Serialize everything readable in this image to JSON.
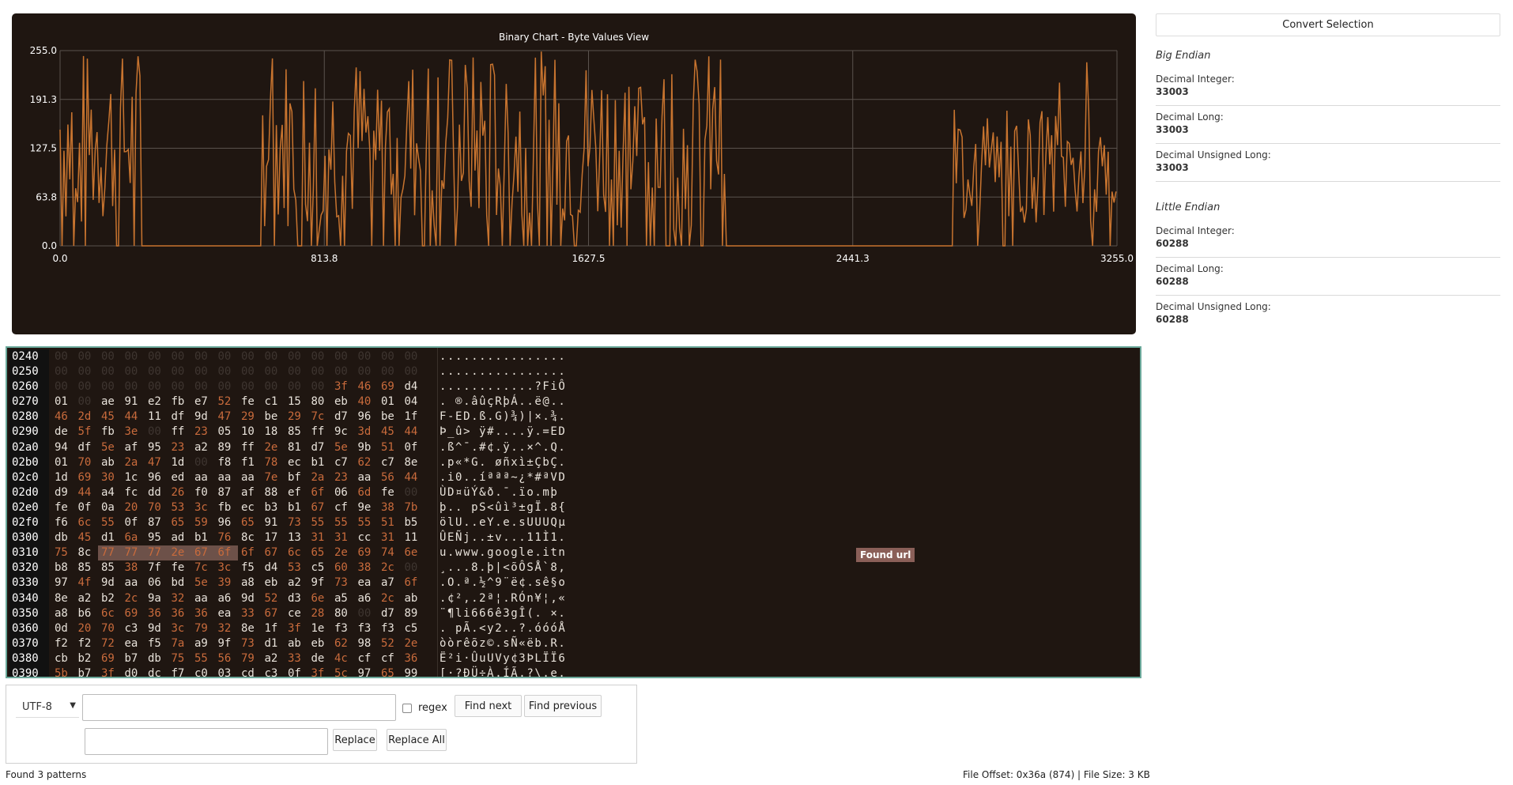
{
  "chart": {
    "title": "Binary Chart - Byte Values View",
    "y_ticks": [
      "255.0",
      "191.3",
      "127.5",
      "63.8",
      "0.0"
    ],
    "x_ticks": [
      "0.0",
      "813.8",
      "1627.5",
      "2441.3",
      "3255.0"
    ],
    "line_color": "#c8742f",
    "background": "#1f1611"
  },
  "chart_data": {
    "type": "line",
    "title": "Binary Chart - Byte Values View",
    "xlim": [
      0,
      3255
    ],
    "ylim": [
      0,
      255
    ],
    "grid": true,
    "series": [
      {
        "values_note_segments": [
          {
            "range": [
              0,
              250
            ],
            "kind": "dense-high"
          },
          {
            "range": [
              250,
              620
            ],
            "kind": "zero"
          },
          {
            "range": [
              620,
              2050
            ],
            "kind": "dense-high"
          },
          {
            "range": [
              2050,
              2750
            ],
            "kind": "zero"
          },
          {
            "range": [
              2750,
              3255
            ],
            "kind": "dense-mid"
          }
        ]
      }
    ]
  },
  "hex": {
    "rows": [
      {
        "addr": "0240",
        "bytes": [
          "00",
          "00",
          "00",
          "00",
          "00",
          "00",
          "00",
          "00",
          "00",
          "00",
          "00",
          "00",
          "00",
          "00",
          "00",
          "00"
        ],
        "ascii": "................"
      },
      {
        "addr": "0250",
        "bytes": [
          "00",
          "00",
          "00",
          "00",
          "00",
          "00",
          "00",
          "00",
          "00",
          "00",
          "00",
          "00",
          "00",
          "00",
          "00",
          "00"
        ],
        "ascii": "................"
      },
      {
        "addr": "0260",
        "bytes": [
          "00",
          "00",
          "00",
          "00",
          "00",
          "00",
          "00",
          "00",
          "00",
          "00",
          "00",
          "00",
          "3f",
          "46",
          "69",
          "d4"
        ],
        "ascii": "............?FiÔ"
      },
      {
        "addr": "0270",
        "bytes": [
          "01",
          "00",
          "ae",
          "91",
          "e2",
          "fb",
          "e7",
          "52",
          "fe",
          "c1",
          "15",
          "80",
          "eb",
          "40",
          "01",
          "04"
        ],
        "ascii": ". ®.âûçRþÁ..ë@.."
      },
      {
        "addr": "0280",
        "bytes": [
          "46",
          "2d",
          "45",
          "44",
          "11",
          "df",
          "9d",
          "47",
          "29",
          "be",
          "29",
          "7c",
          "d7",
          "96",
          "be",
          "1f"
        ],
        "ascii": "F-ED.ß.G)¾)|×.¾."
      },
      {
        "addr": "0290",
        "bytes": [
          "de",
          "5f",
          "fb",
          "3e",
          "00",
          "ff",
          "23",
          "05",
          "10",
          "18",
          "85",
          "ff",
          "9c",
          "3d",
          "45",
          "44"
        ],
        "ascii": "Þ_û> ÿ#....ÿ.=ED"
      },
      {
        "addr": "02a0",
        "bytes": [
          "94",
          "df",
          "5e",
          "af",
          "95",
          "23",
          "a2",
          "89",
          "ff",
          "2e",
          "81",
          "d7",
          "5e",
          "9b",
          "51",
          "0f"
        ],
        "ascii": ".ß^¯.#¢.ÿ..×^.Q."
      },
      {
        "addr": "02b0",
        "bytes": [
          "01",
          "70",
          "ab",
          "2a",
          "47",
          "1d",
          "00",
          "f8",
          "f1",
          "78",
          "ec",
          "b1",
          "c7",
          "62",
          "c7",
          "8e"
        ],
        "ascii": ".p«*G. øñxì±ÇbÇ."
      },
      {
        "addr": "02c0",
        "bytes": [
          "1d",
          "69",
          "30",
          "1c",
          "96",
          "ed",
          "aa",
          "aa",
          "aa",
          "7e",
          "bf",
          "2a",
          "23",
          "aa",
          "56",
          "44"
        ],
        "ascii": ".i0..íªªª~¿*#ªVD"
      },
      {
        "addr": "02d0",
        "bytes": [
          "d9",
          "44",
          "a4",
          "fc",
          "dd",
          "26",
          "f0",
          "87",
          "af",
          "88",
          "ef",
          "6f",
          "06",
          "6d",
          "fe",
          "00"
        ],
        "ascii": "ÙD¤üÝ&ð.¯.ïo.mþ"
      },
      {
        "addr": "02e0",
        "bytes": [
          "fe",
          "0f",
          "0a",
          "20",
          "70",
          "53",
          "3c",
          "fb",
          "ec",
          "b3",
          "b1",
          "67",
          "cf",
          "9e",
          "38",
          "7b"
        ],
        "ascii": "þ.. pS<ûì³±gÏ.8{"
      },
      {
        "addr": "02f0",
        "bytes": [
          "f6",
          "6c",
          "55",
          "0f",
          "87",
          "65",
          "59",
          "96",
          "65",
          "91",
          "73",
          "55",
          "55",
          "55",
          "51",
          "b5"
        ],
        "ascii": "ölU..eY.e.sUUUQµ"
      },
      {
        "addr": "0300",
        "bytes": [
          "db",
          "45",
          "d1",
          "6a",
          "95",
          "ad",
          "b1",
          "76",
          "8c",
          "17",
          "13",
          "31",
          "31",
          "cc",
          "31",
          "11"
        ],
        "ascii": "ÛEÑj..±v...11Ì1."
      },
      {
        "addr": "0310",
        "bytes": [
          "75",
          "8c",
          "77",
          "77",
          "77",
          "2e",
          "67",
          "6f",
          "6f",
          "67",
          "6c",
          "65",
          "2e",
          "69",
          "74",
          "6e"
        ],
        "ascii": "u.www.google.itn"
      },
      {
        "addr": "0320",
        "bytes": [
          "b8",
          "85",
          "85",
          "38",
          "7f",
          "fe",
          "7c",
          "3c",
          "f5",
          "d4",
          "53",
          "c5",
          "60",
          "38",
          "2c",
          "00"
        ],
        "ascii": "¸...8.þ|<õÔSÅ`8,"
      },
      {
        "addr": "0330",
        "bytes": [
          "97",
          "4f",
          "9d",
          "aa",
          "06",
          "bd",
          "5e",
          "39",
          "a8",
          "eb",
          "a2",
          "9f",
          "73",
          "ea",
          "a7",
          "6f"
        ],
        "ascii": ".O.ª.½^9¨ë¢.sê§o"
      },
      {
        "addr": "0340",
        "bytes": [
          "8e",
          "a2",
          "b2",
          "2c",
          "9a",
          "32",
          "aa",
          "a6",
          "9d",
          "52",
          "d3",
          "6e",
          "a5",
          "a6",
          "2c",
          "ab"
        ],
        "ascii": ".¢²,.2ª¦.RÓn¥¦,«"
      },
      {
        "addr": "0350",
        "bytes": [
          "a8",
          "b6",
          "6c",
          "69",
          "36",
          "36",
          "36",
          "ea",
          "33",
          "67",
          "ce",
          "28",
          "80",
          "00",
          "d7",
          "89"
        ],
        "ascii": "¨¶li666ê3gÎ(. ×."
      },
      {
        "addr": "0360",
        "bytes": [
          "0d",
          "20",
          "70",
          "c3",
          "9d",
          "3c",
          "79",
          "32",
          "8e",
          "1f",
          "3f",
          "1e",
          "f3",
          "f3",
          "f3",
          "c5"
        ],
        "ascii": ". pÃ.<y2..?.óóóÅ"
      },
      {
        "addr": "0370",
        "bytes": [
          "f2",
          "f2",
          "72",
          "ea",
          "f5",
          "7a",
          "a9",
          "9f",
          "73",
          "d1",
          "ab",
          "eb",
          "62",
          "98",
          "52",
          "2e"
        ],
        "ascii": "òòrêõz©.sÑ«ëb.R."
      },
      {
        "addr": "0380",
        "bytes": [
          "cb",
          "b2",
          "69",
          "b7",
          "db",
          "75",
          "55",
          "56",
          "79",
          "a2",
          "33",
          "de",
          "4c",
          "cf",
          "cf",
          "36"
        ],
        "ascii": "Ë²i·ÛuUVy¢3ÞLÏÏ6"
      },
      {
        "addr": "0390",
        "bytes": [
          "5b",
          "b7",
          "3f",
          "d0",
          "dc",
          "f7",
          "c0",
          "03",
          "cd",
          "c3",
          "0f",
          "3f",
          "5c",
          "97",
          "65",
          "99"
        ],
        "ascii": "[·?ÐÜ÷À.ÍÃ.?\\.e."
      }
    ],
    "found_label": "Found url"
  },
  "search": {
    "encoding": "UTF-8",
    "search_value": "",
    "replace_value": "",
    "regex_label": "regex",
    "find_next": "Find next",
    "find_previous": "Find previous",
    "replace": "Replace",
    "replace_all": "Replace All"
  },
  "status": {
    "left": "Found 3 patterns",
    "right": "File Offset: 0x36a (874) | File Size: 3 KB"
  },
  "convert": {
    "button": "Convert Selection",
    "big_endian": {
      "title": "Big Endian",
      "items": [
        {
          "label": "Decimal Integer:",
          "value": "33003"
        },
        {
          "label": "Decimal Long:",
          "value": "33003"
        },
        {
          "label": "Decimal Unsigned Long:",
          "value": "33003"
        }
      ]
    },
    "little_endian": {
      "title": "Little Endian",
      "items": [
        {
          "label": "Decimal Integer:",
          "value": "60288"
        },
        {
          "label": "Decimal Long:",
          "value": "60288"
        },
        {
          "label": "Decimal Unsigned Long:",
          "value": "60288"
        }
      ]
    }
  }
}
